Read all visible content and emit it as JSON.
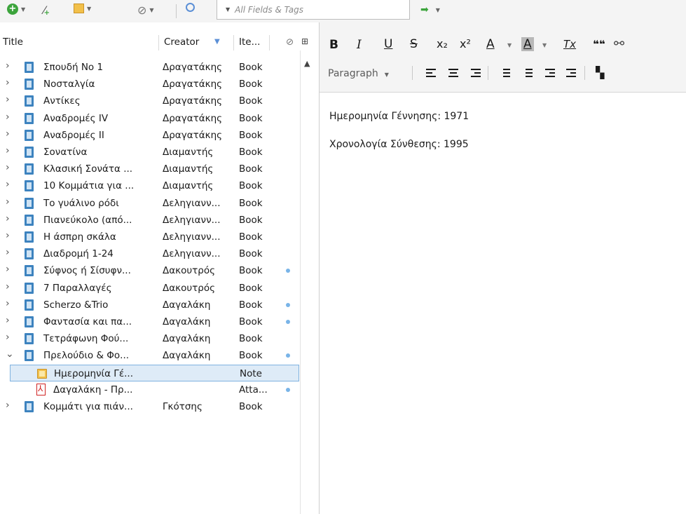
{
  "toolbar": {
    "search_placeholder": "All Fields & Tags",
    "search_mode_icon": "dropdown-caret"
  },
  "tree": {
    "columns": {
      "title": "Title",
      "creator": "Creator",
      "item_type": "Ite..."
    },
    "rows": [
      {
        "title": "Σπουδή No 1",
        "creator": "Δραγατάκης",
        "type": "Book",
        "attachment": false,
        "kind": "book"
      },
      {
        "title": "Νοσταλγία",
        "creator": "Δραγατάκης",
        "type": "Book",
        "attachment": false,
        "kind": "book"
      },
      {
        "title": "Αντίκες",
        "creator": "Δραγατάκης",
        "type": "Book",
        "attachment": false,
        "kind": "book"
      },
      {
        "title": "Αναδρομές IV",
        "creator": "Δραγατάκης",
        "type": "Book",
        "attachment": false,
        "kind": "book"
      },
      {
        "title": "Αναδρομές ΙΙ",
        "creator": "Δραγατάκης",
        "type": "Book",
        "attachment": false,
        "kind": "book"
      },
      {
        "title": "Σονατίνα",
        "creator": "Διαμαντής",
        "type": "Book",
        "attachment": false,
        "kind": "book"
      },
      {
        "title": "Κλασική Σονάτα ...",
        "creator": "Διαμαντής",
        "type": "Book",
        "attachment": false,
        "kind": "book"
      },
      {
        "title": "10 Κομμάτια για ...",
        "creator": "Διαμαντής",
        "type": "Book",
        "attachment": false,
        "kind": "book"
      },
      {
        "title": "Το γυάλινο ρόδι",
        "creator": "Δεληγιανν...",
        "type": "Book",
        "attachment": false,
        "kind": "book"
      },
      {
        "title": "Πιανεύκολο (από...",
        "creator": "Δεληγιανν...",
        "type": "Book",
        "attachment": false,
        "kind": "book"
      },
      {
        "title": "Η άσπρη σκάλα",
        "creator": "Δεληγιανν...",
        "type": "Book",
        "attachment": false,
        "kind": "book"
      },
      {
        "title": "Διαδρομή 1-24",
        "creator": "Δεληγιανν...",
        "type": "Book",
        "attachment": false,
        "kind": "book"
      },
      {
        "title": "Σύφνος ή Σίσυφν...",
        "creator": "Δακουτρός",
        "type": "Book",
        "attachment": true,
        "kind": "book"
      },
      {
        "title": "7 Παραλλαγές",
        "creator": "Δακουτρός",
        "type": "Book",
        "attachment": false,
        "kind": "book"
      },
      {
        "title": "Scherzo &Trio",
        "creator": "Δαγαλάκη",
        "type": "Book",
        "attachment": true,
        "kind": "book"
      },
      {
        "title": "Φαντασία και πα...",
        "creator": "Δαγαλάκη",
        "type": "Book",
        "attachment": true,
        "kind": "book"
      },
      {
        "title": "Τετράφωνη Φού...",
        "creator": "Δαγαλάκη",
        "type": "Book",
        "attachment": false,
        "kind": "book"
      },
      {
        "title": "Πρελούδιο & Φο...",
        "creator": "Δαγαλάκη",
        "type": "Book",
        "attachment": true,
        "kind": "book",
        "expanded": true
      },
      {
        "title": "Ημερομηνία Γέ...",
        "creator": "",
        "type": "Note",
        "attachment": false,
        "kind": "note",
        "selected": true
      },
      {
        "title": "Δαγαλάκη - Πρ...",
        "creator": "",
        "type": "Atta...",
        "attachment": true,
        "kind": "pdf"
      },
      {
        "title": "Κομμάτι για πιάν...",
        "creator": "Γκότσης",
        "type": "Book",
        "attachment": false,
        "kind": "book"
      }
    ]
  },
  "editor": {
    "format_buttons": {
      "bold": "B",
      "italic": "I",
      "underline": "U",
      "strike": "S",
      "subscript": "x₂",
      "superscript": "x²",
      "text_color": "A",
      "highlight": "A",
      "clear_format": "Tx",
      "quote": "❝❝"
    },
    "paragraph_format": "Paragraph",
    "highlight_color": "#b8b8b8",
    "note_lines": [
      "Ημερομηνία Γέννησης: 1971",
      "Χρονολογία Σύνθεσης:  1995"
    ]
  }
}
